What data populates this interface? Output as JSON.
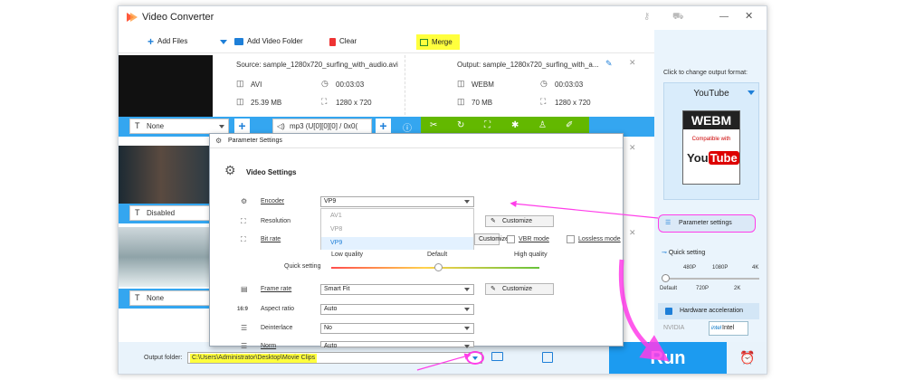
{
  "app": {
    "title": "Video Converter"
  },
  "toolbar": {
    "add_files": "Add Files",
    "add_folder": "Add Video Folder",
    "clear": "Clear",
    "merge": "Merge"
  },
  "file": {
    "source": "Source: sample_1280x720_surfing_with_audio.avi",
    "output": "Output: sample_1280x720_surfing_with_a...",
    "src_format": "AVI",
    "src_duration": "00:03:03",
    "src_size": "25.39 MB",
    "src_resolution": "1280 x 720",
    "out_format": "WEBM",
    "out_duration": "00:03:03",
    "out_size": "70 MB",
    "out_resolution": "1280 x 720"
  },
  "rows": {
    "subtitle1": "None",
    "audio": "mp3 (U[0][0][0] / 0x0(",
    "subtitle2": "Disabled",
    "subtitle3": "None"
  },
  "dialog": {
    "title": "Parameter Settings",
    "section": "Video Settings",
    "encoder_label": "Encoder",
    "encoder_value": "VP9",
    "encoder_options": [
      "AV1",
      "VP8",
      "VP9"
    ],
    "resolution_label": "Resolution",
    "bitrate_label": "Bit rate",
    "customize": "Customize",
    "vbr": "VBR mode",
    "lossless": "Lossless mode",
    "quick_setting": "Quick setting",
    "low_quality": "Low quality",
    "default": "Default",
    "high_quality": "High quality",
    "framerate_label": "Frame rate",
    "framerate_value": "Smart Fit",
    "aspect_label": "Aspect ratio",
    "aspect_value": "Auto",
    "deinterlace_label": "Deinterlace",
    "deinterlace_value": "No",
    "norm_label": "Norm",
    "norm_value": "Auto"
  },
  "panel": {
    "click_to_change": "Click to change output format:",
    "format_name": "YouTube",
    "webm": "WEBM",
    "compatible": "Compatible with",
    "you": "You",
    "tube": "Tube",
    "param_settings": "Parameter settings",
    "quick_setting": "Quick setting",
    "ticks_top": [
      "480P",
      "1080P",
      "4K"
    ],
    "ticks_bottom": [
      "Default",
      "720P",
      "2K"
    ],
    "hw_accel": "Hardware acceleration",
    "nvidia": "NVIDIA",
    "intel": "Intel"
  },
  "bottom": {
    "output_folder_label": "Output folder:",
    "output_path": "C:\\Users\\Administrator\\Desktop\\Movie Clips",
    "run": "Run"
  },
  "colors": {
    "accent": "#34a6f0",
    "highlight": "#ffff3d",
    "run_bg": "#1c9bf0",
    "merge_bg": "#ffff3d",
    "arrow": "#ff3de9"
  }
}
